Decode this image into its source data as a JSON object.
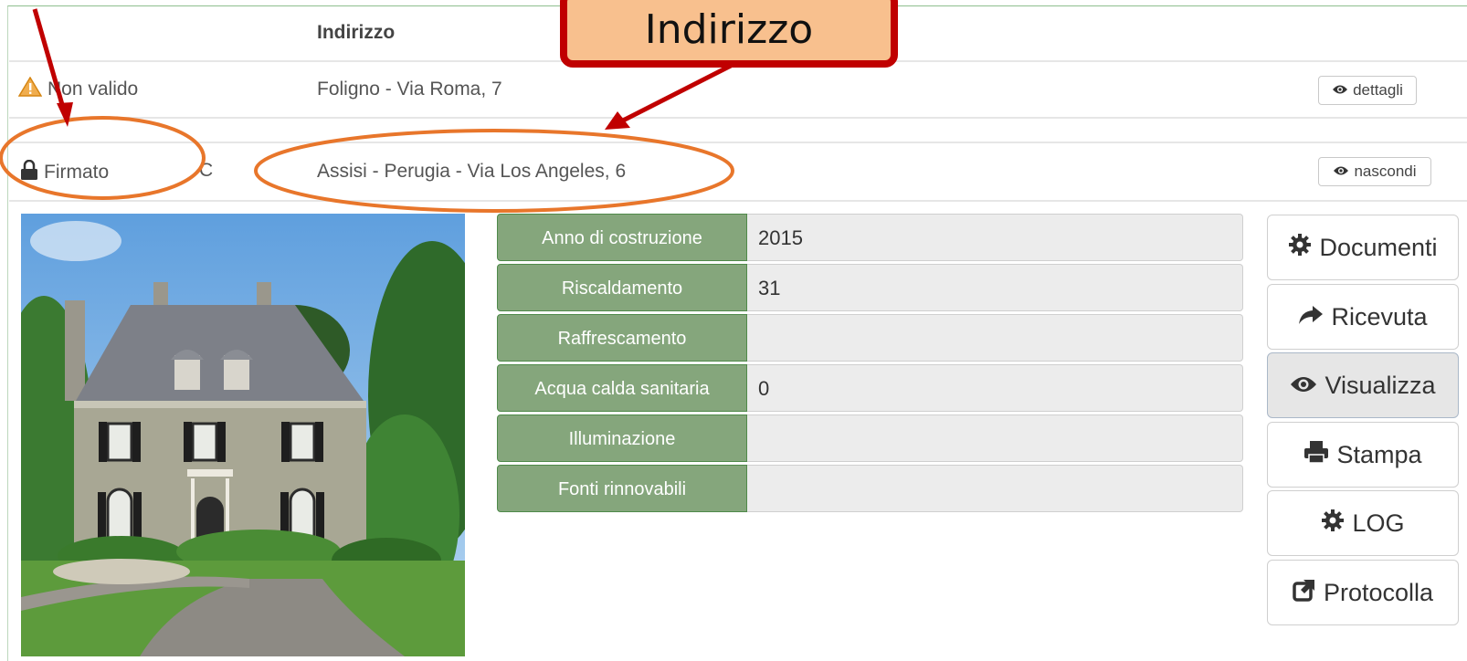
{
  "table": {
    "header_address": "Indirizzo",
    "rows": [
      {
        "status": "Non valido",
        "address": "Foligno - Via Roma, 7",
        "action": "dettagli"
      },
      {
        "status": "Firmato",
        "extra": "C",
        "address": "Assisi - Perugia - Via Los Angeles, 6",
        "action": "nascondi"
      }
    ]
  },
  "details": {
    "rows": [
      {
        "label": "Anno di costruzione",
        "value": "2015"
      },
      {
        "label": "Riscaldamento",
        "value": "31"
      },
      {
        "label": "Raffrescamento",
        "value": ""
      },
      {
        "label": "Acqua calda sanitaria",
        "value": "0"
      },
      {
        "label": "Illuminazione",
        "value": ""
      },
      {
        "label": "Fonti rinnovabili",
        "value": ""
      }
    ]
  },
  "actions": {
    "documenti": "Documenti",
    "ricevuta": "Ricevuta",
    "visualizza": "Visualizza",
    "stampa": "Stampa",
    "log": "LOG",
    "protocolla": "Protocolla"
  },
  "annotation": {
    "callout": "Indirizzo"
  },
  "colors": {
    "label_green": "#85a67c",
    "annotation_red": "#c00000",
    "annotation_orange": "#e8762b",
    "callout_fill": "#f8c08e"
  }
}
